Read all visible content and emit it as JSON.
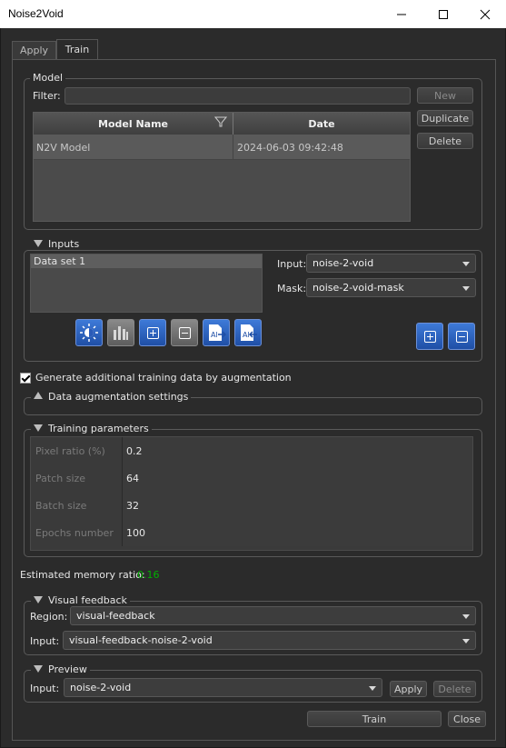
{
  "window": {
    "title": "Noise2Void"
  },
  "tabs": [
    {
      "label": "Apply"
    },
    {
      "label": "Train"
    }
  ],
  "model": {
    "group_title": "Model",
    "filter_label": "Filter:",
    "filter_value": "",
    "buttons": {
      "new": "New",
      "duplicate": "Duplicate",
      "delete": "Delete"
    },
    "columns": [
      "Model Name",
      "Date"
    ],
    "rows": [
      {
        "name": "N2V Model",
        "date": "2024-06-03 09:42:48"
      }
    ]
  },
  "inputs": {
    "group_title": "Inputs",
    "datasets": [
      "Data set 1"
    ],
    "input_label": "Input:",
    "input_value": "noise-2-void",
    "mask_label": "Mask:",
    "mask_value": "noise-2-void-mask",
    "toolbar_icons": [
      "brightness-icon",
      "histogram-icon",
      "add-icon",
      "remove-icon",
      "import-icon",
      "export-icon"
    ]
  },
  "augmentation": {
    "checkbox_label": "Generate additional training data by augmentation",
    "checked": true,
    "settings_title": "Data augmentation settings"
  },
  "training": {
    "group_title": "Training parameters",
    "params": [
      {
        "name": "Pixel ratio (%)",
        "value": "0.2"
      },
      {
        "name": "Patch size",
        "value": "64"
      },
      {
        "name": "Batch size",
        "value": "32"
      },
      {
        "name": "Epochs number",
        "value": "100"
      }
    ]
  },
  "memory": {
    "label": "Estimated memory ratio:",
    "value": "0.16",
    "value_color": "#00b000"
  },
  "visual_feedback": {
    "group_title": "Visual feedback",
    "region_label": "Region:",
    "region_value": "visual-feedback",
    "input_label": "Input:",
    "input_value": "visual-feedback-noise-2-void"
  },
  "preview": {
    "group_title": "Preview",
    "input_label": "Input:",
    "input_value": "noise-2-void",
    "apply_label": "Apply",
    "delete_label": "Delete"
  },
  "footer": {
    "train_label": "Train",
    "close_label": "Close"
  },
  "colors": {
    "accent_blue": "#2f62c0",
    "background": "#2b2b2b"
  }
}
